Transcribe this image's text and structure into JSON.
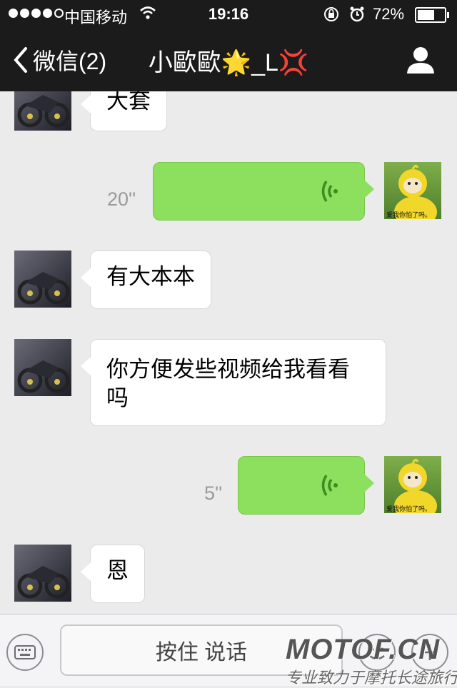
{
  "status_bar": {
    "carrier": "中国移动",
    "time": "19:16",
    "battery_percent": "72%",
    "battery_level": 0.72,
    "signal_bars": 4
  },
  "nav": {
    "back_label": "微信(2)",
    "title": "小歐歐🌟_L💢"
  },
  "messages": [
    {
      "direction": "in",
      "type": "text",
      "text": "大套"
    },
    {
      "direction": "out",
      "type": "voice",
      "duration": "20''"
    },
    {
      "direction": "in",
      "type": "text",
      "text": "有大本本"
    },
    {
      "direction": "in",
      "type": "text",
      "text": "你方便发些视频给我看看吗"
    },
    {
      "direction": "out",
      "type": "voice",
      "duration": "5''"
    },
    {
      "direction": "in",
      "type": "text",
      "text": "恩"
    }
  ],
  "avatar_caption": "爱我你怕了吗。",
  "input_bar": {
    "hold_to_talk_label": "按住 说话"
  },
  "watermark": {
    "logo": "MOTOF.CN",
    "tagline": "专业致力于摩托长途旅行"
  },
  "colors": {
    "nav_bg": "#1b1b1b",
    "chat_bg": "#ebebeb",
    "outgoing_bubble": "#8ce05d",
    "incoming_bubble": "#ffffff"
  }
}
